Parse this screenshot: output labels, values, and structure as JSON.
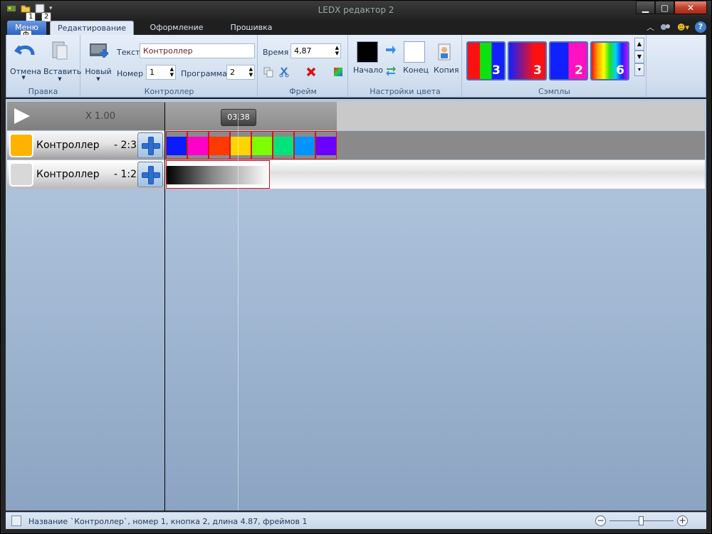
{
  "window": {
    "title": "LEDX редактор 2"
  },
  "qat": {
    "keytip_1": "1",
    "keytip_2": "2",
    "keytip_menu": "Ф"
  },
  "tabs": {
    "menu": "Меню",
    "edit": "Редактирование",
    "design": "Оформление",
    "firmware": "Прошивка"
  },
  "ribbon": {
    "edit_group": {
      "label": "Правка",
      "undo": "Отмена",
      "paste": "Вставить"
    },
    "controller_group": {
      "label": "Контроллер",
      "new": "Новый",
      "text_label": "Текст",
      "text_value": "Контроллер",
      "number_label": "Номер",
      "number_value": "1",
      "program_label": "Программа",
      "program_value": "2"
    },
    "frame_group": {
      "label": "Фрейм",
      "time_label": "Время",
      "time_value": "4,87"
    },
    "color_group": {
      "label": "Настройки цвета",
      "start": "Начало",
      "end": "Конец",
      "copy": "Копия",
      "start_color": "#000000",
      "end_color": "#ffffff"
    },
    "samples_group": {
      "label": "Сэмплы",
      "samples": [
        "3",
        "3",
        "2",
        "6"
      ]
    }
  },
  "timeline": {
    "zoom": "X 1.00",
    "time": "03.38"
  },
  "tracks": [
    {
      "name": "Контроллер",
      "num": "- 2:3",
      "color": "#ffb300",
      "frames": [
        "#0a1cff",
        "#ff00c8",
        "#ff3a00",
        "#ffd400",
        "#7cff00",
        "#00e27a",
        "#0094ff",
        "#6a00ff"
      ]
    },
    {
      "name": "Контроллер",
      "num": "- 1:2",
      "color": "#d8d8d8"
    }
  ],
  "status": {
    "text": "Название `Контроллер`, номер 1, кнопка 2, длина 4.87, фреймов 1"
  }
}
